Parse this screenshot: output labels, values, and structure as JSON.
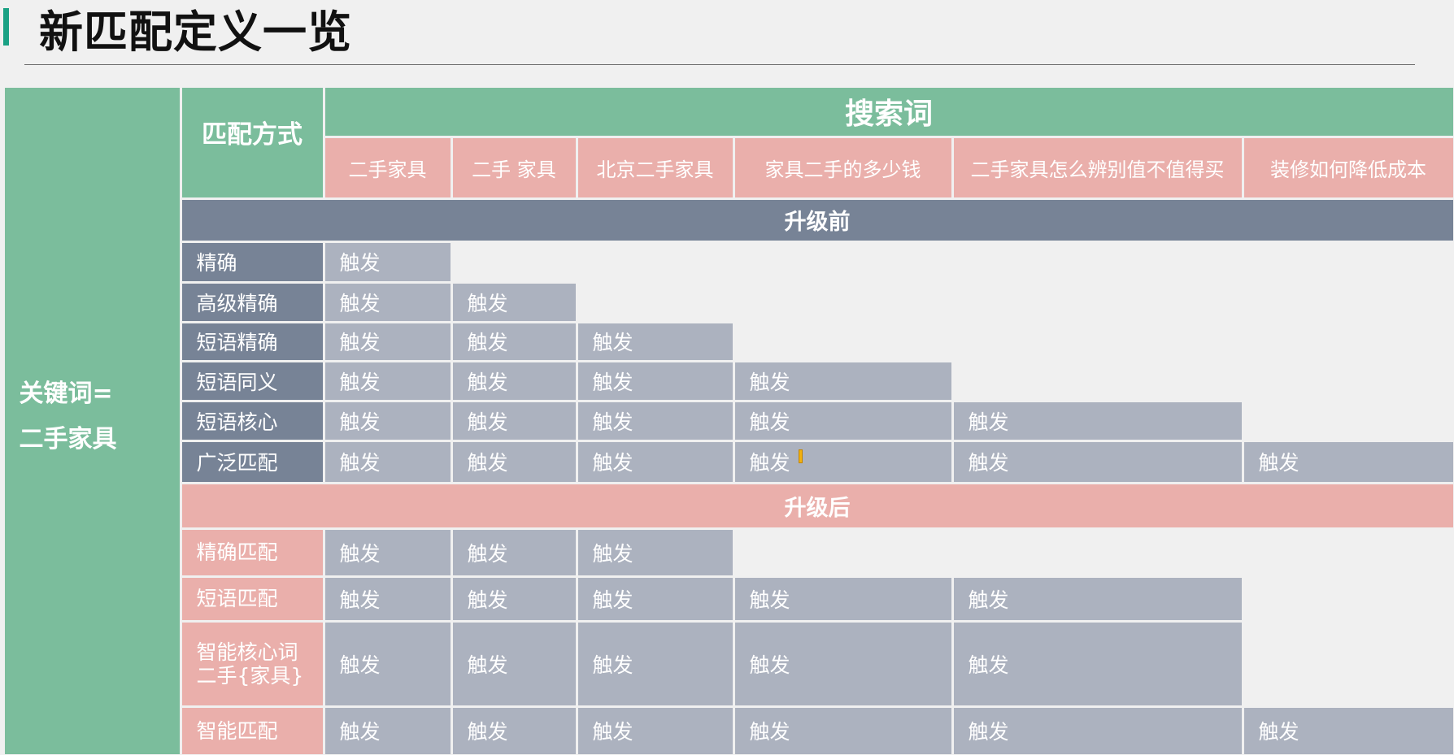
{
  "title": "新匹配定义一览",
  "keyword_cell": {
    "line1": "关键词=",
    "line2": "二手家具"
  },
  "match_header": "匹配方式",
  "search_header": "搜索词",
  "columns": [
    "二手家具",
    "二手 家具",
    "北京二手家具",
    "家具二手的多少钱",
    "二手家具怎么辨别值不值得买",
    "装修如何降低成本"
  ],
  "before": {
    "label": "升级前",
    "rows": [
      {
        "name": "精确",
        "cells": [
          "触发",
          "",
          "",
          "",
          "",
          ""
        ]
      },
      {
        "name": "高级精确",
        "cells": [
          "触发",
          "触发",
          "",
          "",
          "",
          ""
        ]
      },
      {
        "name": "短语精确",
        "cells": [
          "触发",
          "触发",
          "触发",
          "",
          "",
          ""
        ]
      },
      {
        "name": "短语同义",
        "cells": [
          "触发",
          "触发",
          "触发",
          "触发",
          "",
          ""
        ]
      },
      {
        "name": "短语核心",
        "cells": [
          "触发",
          "触发",
          "触发",
          "触发",
          "触发",
          ""
        ]
      },
      {
        "name": "广泛匹配",
        "cells": [
          "触发",
          "触发",
          "触发",
          "触发",
          "触发",
          "触发"
        ]
      }
    ]
  },
  "after": {
    "label": "升级后",
    "rows": [
      {
        "name": "精确匹配",
        "cells": [
          "触发",
          "触发",
          "触发",
          "",
          "",
          ""
        ]
      },
      {
        "name": "短语匹配",
        "cells": [
          "触发",
          "触发",
          "触发",
          "触发",
          "触发",
          ""
        ]
      },
      {
        "name": "智能核心词\n二手{家具}",
        "cells": [
          "触发",
          "触发",
          "触发",
          "触发",
          "触发",
          ""
        ]
      },
      {
        "name": "智能匹配",
        "cells": [
          "触发",
          "触发",
          "触发",
          "触发",
          "触发",
          "触发"
        ]
      }
    ]
  },
  "colors": {
    "accent": "#1aa184",
    "green": "#7bbd9c",
    "pink": "#eaafab",
    "slate": "#778396",
    "gray": "#acb2bf"
  }
}
